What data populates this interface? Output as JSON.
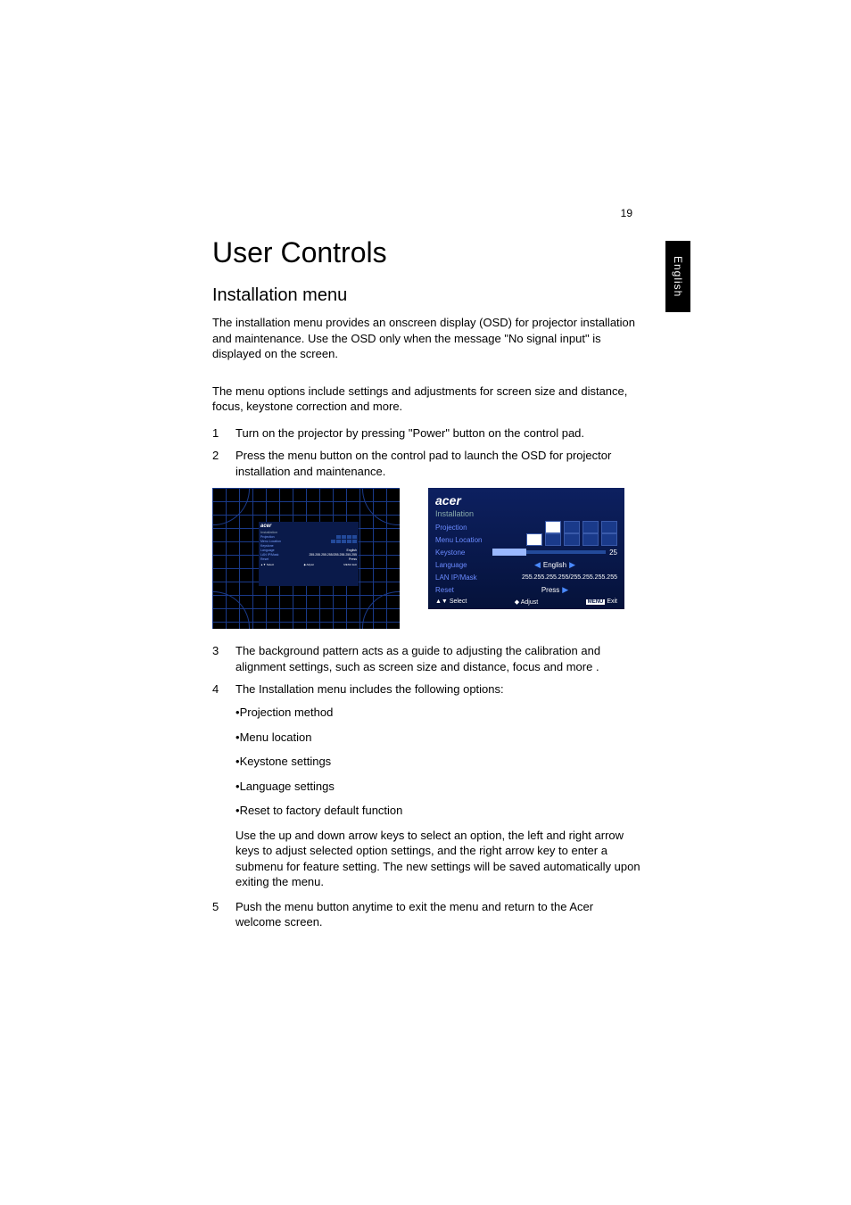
{
  "pageNumber": "19",
  "languageTab": "English",
  "heading1": "User Controls",
  "heading2": "Installation menu",
  "intro1": "The installation menu provides an onscreen display (OSD) for projector installation and maintenance. Use the OSD only when the message \"No signal input\" is displayed on the screen.",
  "intro2": "The menu options include settings and adjustments for screen size and distance, focus, keystone correction and more.",
  "steps": {
    "s1": {
      "num": "1",
      "text": "Turn on the projector by pressing \"Power\" button on the control pad."
    },
    "s2": {
      "num": "2",
      "text": "Press the menu button on the control pad to launch the OSD for projector installation and maintenance."
    },
    "s3": {
      "num": "3",
      "text": "The background pattern acts as a guide to adjusting the calibration and alignment settings, such as screen size and distance, focus and more ."
    },
    "s4": {
      "num": "4",
      "text": "The Installation menu includes the following options:"
    },
    "s5": {
      "num": "5",
      "text": "Push the menu button anytime to exit the menu and return to the Acer welcome screen."
    }
  },
  "bullets": {
    "b1": "Projection method",
    "b2": "Menu location",
    "b3": "Keystone settings",
    "b4": "Language settings",
    "b5": "Reset to factory default function"
  },
  "subpara": "Use the up and down arrow keys to select an option, the left and right arrow keys to adjust selected option settings, and the right arrow key to enter a submenu for feature setting. The new settings will be saved automatically upon exiting the menu.",
  "osd": {
    "brand": "acer",
    "title": "Installation",
    "rows": {
      "projection": "Projection",
      "menuLocation": "Menu Location",
      "keystone": "Keystone",
      "keystoneValue": "25",
      "language": "Language",
      "languageValue": "English",
      "lan": "LAN IP/Mask",
      "lanValue": "255.255.255.255/255.255.255.255",
      "reset": "Reset",
      "resetValue": "Press"
    },
    "footer": {
      "select": "Select",
      "adjust": "Adjust",
      "menu": "MENU",
      "exit": "Exit"
    }
  }
}
